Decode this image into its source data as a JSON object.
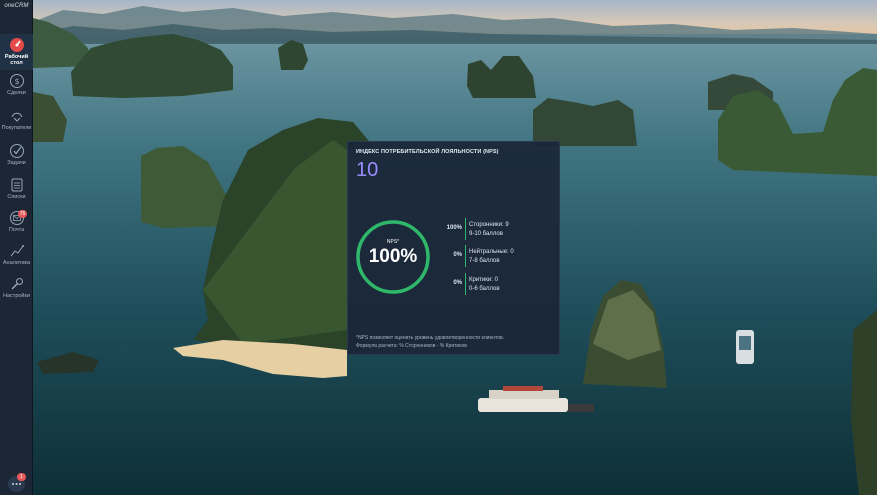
{
  "app": {
    "logo_text": "oneCRM"
  },
  "sidebar": {
    "items": [
      {
        "label": "Рабочий стол",
        "icon": "dashboard-icon",
        "active": true
      },
      {
        "label": "Сделки",
        "icon": "dollar-icon"
      },
      {
        "label": "Покупатели",
        "icon": "handshake-icon"
      },
      {
        "label": "Задачи",
        "icon": "checkmark-icon"
      },
      {
        "label": "Списки",
        "icon": "list-icon"
      },
      {
        "label": "Почта",
        "icon": "mail-icon",
        "badge": "76"
      },
      {
        "label": "Аналитика",
        "icon": "analytics-icon"
      },
      {
        "label": "Настройки",
        "icon": "wrench-icon"
      }
    ],
    "chat": {
      "icon": "chat-icon",
      "badge": "1"
    }
  },
  "nps": {
    "title": "Индекс потребительской лояльности (NPS)",
    "score": "10",
    "gauge_caption": "NPS*",
    "gauge_value": "100%",
    "gauge_fraction": 1.0,
    "rows": [
      {
        "pct": "100%",
        "name": "Сторонники: 9",
        "range": "9-10 баллов"
      },
      {
        "pct": "0%",
        "name": "Нейтральные: 0",
        "range": "7-8 баллов"
      },
      {
        "pct": "0%",
        "name": "Критики: 0",
        "range": "0-6 баллов"
      }
    ],
    "footnote_1": "*NPS позволяет оценить уровень удовлетворенности клиентов.",
    "footnote_2": "Формула расчета: % Сторонников - % Критиков"
  },
  "colors": {
    "accent": "#9b8cff",
    "gauge": "#2fb86a",
    "sidebar": "#1b2735"
  }
}
